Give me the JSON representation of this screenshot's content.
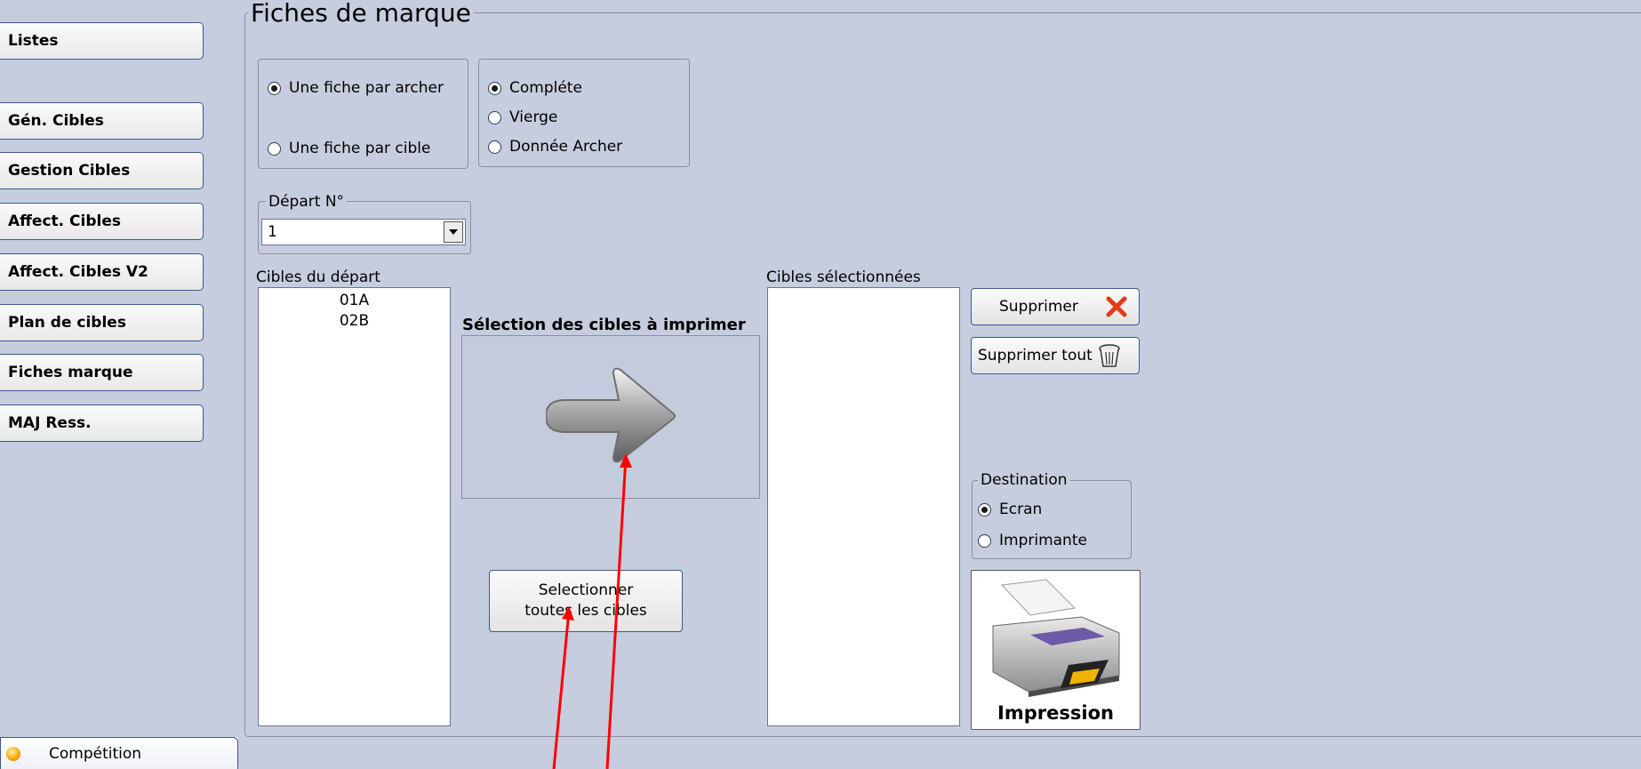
{
  "sidebar": {
    "items": [
      {
        "label": "Listes"
      },
      {
        "label": "Gén. Cibles"
      },
      {
        "label": "Gestion Cibles"
      },
      {
        "label": "Affect. Cibles"
      },
      {
        "label": "Affect. Cibles V2"
      },
      {
        "label": "Plan de cibles"
      },
      {
        "label": "Fiches marque"
      },
      {
        "label": "MAJ Ress."
      }
    ],
    "bottom_tab": {
      "label": "Compétition",
      "icon": "competition-icon"
    }
  },
  "panel": {
    "title": "Fiches de marque"
  },
  "mode_options": {
    "per_archer": "Une fiche par archer",
    "per_target": "Une fiche par cible",
    "selected": "per_archer"
  },
  "content_options": {
    "complete": "Compléte",
    "blank": "Vierge",
    "archer_data": "Donnée Archer",
    "selected": "complete"
  },
  "start": {
    "legend": "Départ N°",
    "value": "1"
  },
  "source_list": {
    "label": "Cibles du départ",
    "items": [
      "01A",
      "02B"
    ]
  },
  "selection": {
    "title": "Sélection des cibles à imprimer",
    "icon": "arrow-right-icon"
  },
  "select_all": {
    "line1": "Selectionner",
    "line2": "toutes les cibles"
  },
  "target_list": {
    "label": "Cibles sélectionnées",
    "items": []
  },
  "delete_button": {
    "label": "Supprimer",
    "icon": "red-x-icon"
  },
  "delete_all_button": {
    "label": "Supprimer tout",
    "icon": "trash-icon"
  },
  "destination": {
    "legend": "Destination",
    "screen": "Ecran",
    "printer": "Imprimante",
    "selected": "screen"
  },
  "print_button": {
    "label": "Impression",
    "icon": "printer-icon"
  },
  "colors": {
    "panel_bg": "#c6cdde",
    "border": "#3b5a8c",
    "annotation": "#ff0000"
  }
}
